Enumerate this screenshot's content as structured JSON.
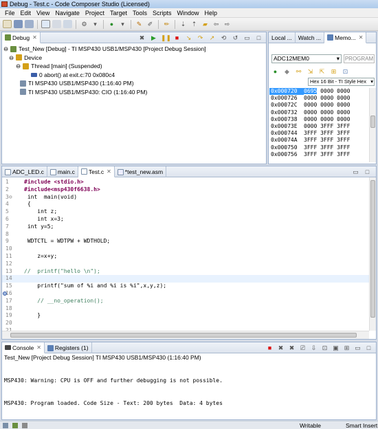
{
  "window": {
    "title": "Debug - Test.c - Code Composer Studio (Licensed)"
  },
  "menu": [
    "File",
    "Edit",
    "View",
    "Navigate",
    "Project",
    "Target",
    "Tools",
    "Scripts",
    "Window",
    "Help"
  ],
  "debug_panel": {
    "tab_label": "Debug",
    "tree": [
      "Test_New [Debug] - TI MSP430 USB1/MSP430 [Project Debug Session]",
      "Device",
      "Thread [main] (Suspended)",
      "0 abort() at exit.c:70 0x080c4",
      "TI MSP430 USB1/MSP430 (1:16:40 PM)",
      "TI MSP430 USB1/MSP430: CIO (1:16:40 PM)"
    ]
  },
  "memory_panel": {
    "tabs": [
      "Local ...",
      "Watch ...",
      "Memo..."
    ],
    "address_value": "ADC12MEM0",
    "program_label": "PROGRAM",
    "format_label": "Hex 16 Bit - TI Style Hex",
    "rows": [
      {
        "addr": "0x000720",
        "vals": "0695 0000 0000"
      },
      {
        "addr": "0x000726",
        "vals": "0000 0000 0000"
      },
      {
        "addr": "0x00072C",
        "vals": "0000 0000 0000"
      },
      {
        "addr": "0x000732",
        "vals": "0000 0000 0000"
      },
      {
        "addr": "0x000738",
        "vals": "0000 0000 0000"
      },
      {
        "addr": "0x00073E",
        "vals": "0000 3FFF 3FFF"
      },
      {
        "addr": "0x000744",
        "vals": "3FFF 3FFF 3FFF"
      },
      {
        "addr": "0x00074A",
        "vals": "3FFF 3FFF 3FFF"
      },
      {
        "addr": "0x000750",
        "vals": "3FFF 3FFF 3FFF"
      },
      {
        "addr": "0x000756",
        "vals": "3FFF 3FFF 3FFF"
      }
    ]
  },
  "editor": {
    "tabs": [
      "ADC_LED.c",
      "main.c",
      "Test.c",
      "*test_new.asm"
    ],
    "lines": [
      {
        "num": "1",
        "text": "#include <stdio.h>"
      },
      {
        "num": "2",
        "text": "#include<msp430f6638.h>"
      },
      {
        "num": "3⊖",
        "text": " int  main(void)"
      },
      {
        "num": "4",
        "text": " {"
      },
      {
        "num": "5",
        "text": "    int z;"
      },
      {
        "num": "6",
        "text": "    int x=3;"
      },
      {
        "num": "7",
        "text": " int y=5;"
      },
      {
        "num": "8",
        "text": ""
      },
      {
        "num": "9",
        "text": " WDTCTL = WDTPW + WDTHOLD;"
      },
      {
        "num": "10",
        "text": ""
      },
      {
        "num": "11",
        "text": "    z=x+y;"
      },
      {
        "num": "12",
        "text": ""
      },
      {
        "num": "13",
        "text": "//  printf(\"hello \\n\");"
      },
      {
        "num": "14",
        "text": ""
      },
      {
        "num": "15",
        "text": "    printf(\"sum of %i and %i is %i\",x,y,z);"
      },
      {
        "num": "16",
        "text": ""
      },
      {
        "num": "17",
        "text": "    // __no_operation();"
      },
      {
        "num": "18",
        "text": ""
      },
      {
        "num": "19",
        "text": "    }"
      },
      {
        "num": "20",
        "text": ""
      },
      {
        "num": "21",
        "text": ""
      }
    ]
  },
  "console": {
    "tabs": [
      "Console",
      "Registers (1)"
    ],
    "session_title": "Test_New [Project Debug Session] TI MSP430 USB1/MSP430 (1:16:40 PM)",
    "lines": [
      "MSP430: Warning: CPU is OFF and further debugging is not possible.",
      "MSP430: Program loaded. Code Size - Text: 200 bytes  Data: 4 bytes"
    ]
  },
  "statusbar": {
    "mode": "Writable",
    "insert": "Smart Insert"
  }
}
